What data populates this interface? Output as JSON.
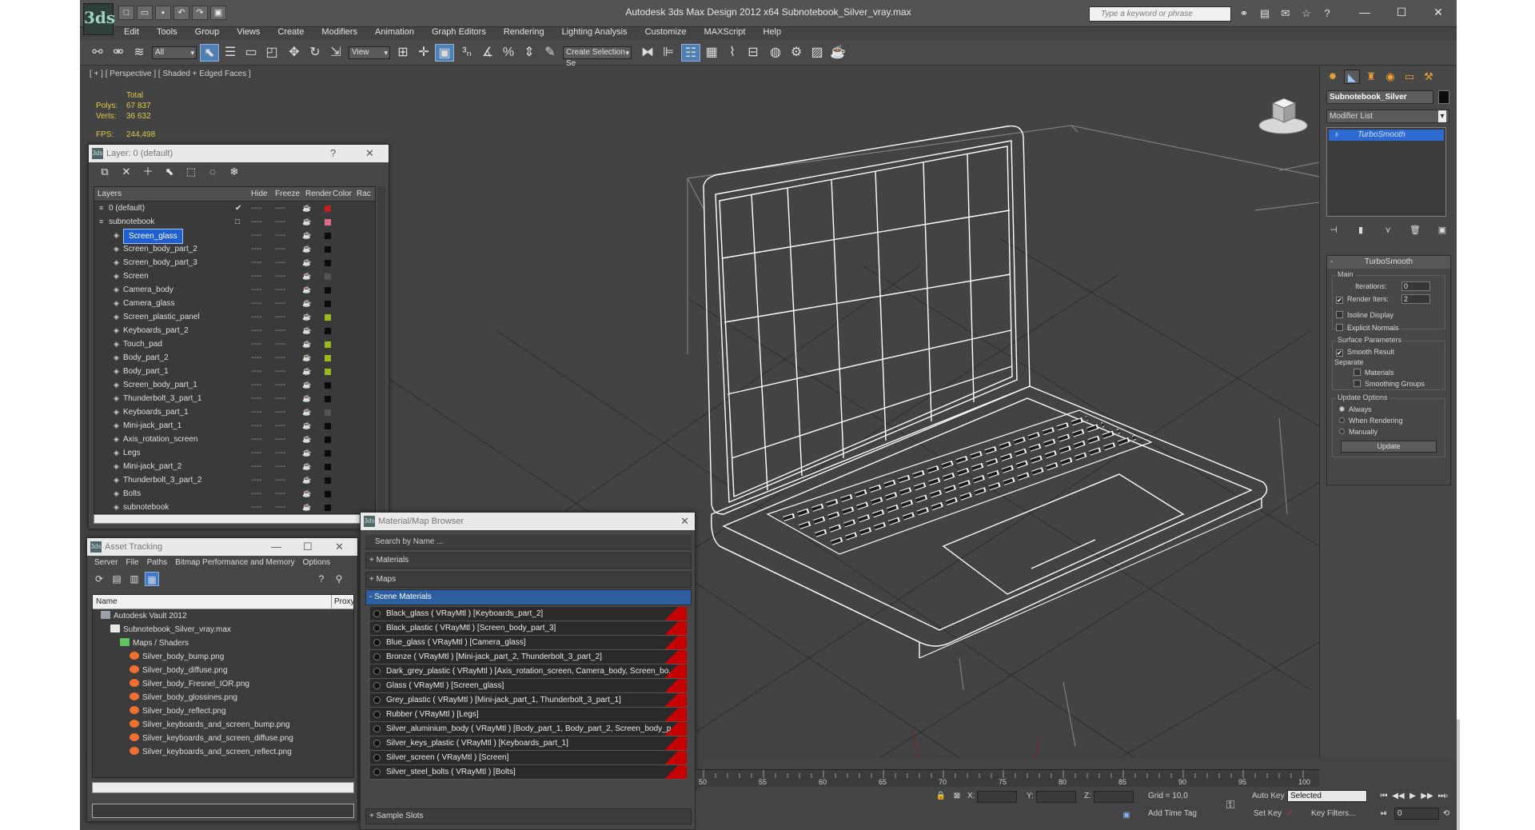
{
  "app": {
    "title": "Autodesk 3ds Max Design 2012 x64      Subnotebook_Silver_vray.max",
    "logo": "3ds",
    "search_placeholder": "Type a keyword or phrase"
  },
  "quick_access": [
    "new-file",
    "open-file",
    "save-file",
    "undo",
    "redo",
    "project-folder"
  ],
  "menu": [
    "Edit",
    "Tools",
    "Group",
    "Views",
    "Create",
    "Modifiers",
    "Animation",
    "Graph Editors",
    "Rendering",
    "Lighting Analysis",
    "Customize",
    "MAXScript",
    "Help"
  ],
  "toolbar": {
    "selection_filter": "All",
    "ref_coord": "View",
    "named_selection": "Create Selection Se"
  },
  "viewport": {
    "label": "[ + ] [ Perspective ] [ Shaded + Edged Faces ]",
    "stats": {
      "header": "Total",
      "polys_label": "Polys:",
      "polys_value": "67 837",
      "verts_label": "Verts:",
      "verts_value": "36 632",
      "fps_label": "FPS:",
      "fps_value": "244,498"
    }
  },
  "layer_window": {
    "title": "Layer: 0 (default)",
    "columns": [
      "Layers",
      "Hide",
      "Freeze",
      "Render",
      "Color",
      "Rac"
    ],
    "rows": [
      {
        "name": "0 (default)",
        "top": true,
        "color": "#c0202a",
        "check": "✔"
      },
      {
        "name": "subnotebook",
        "top": true,
        "color": "#e06a88",
        "check": "□"
      },
      {
        "name": "Screen_glass",
        "color": "#0b0b0b",
        "selected": true
      },
      {
        "name": "Screen_body_part_2",
        "color": "#0b0b0b"
      },
      {
        "name": "Screen_body_part_3",
        "color": "#0b0b0b"
      },
      {
        "name": "Screen",
        "color": "#555555"
      },
      {
        "name": "Camera_body",
        "color": "#0b0b0b"
      },
      {
        "name": "Camera_glass",
        "color": "#0b0b0b"
      },
      {
        "name": "Screen_plastic_panel",
        "color": "#9ab820"
      },
      {
        "name": "Keyboards_part_2",
        "color": "#0b0b0b"
      },
      {
        "name": "Touch_pad",
        "color": "#9ab820"
      },
      {
        "name": "Body_part_2",
        "color": "#9ab820"
      },
      {
        "name": "Body_part_1",
        "color": "#9ab820"
      },
      {
        "name": "Screen_body_part_1",
        "color": "#0b0b0b"
      },
      {
        "name": "Thunderbolt_3_part_1",
        "color": "#0b0b0b"
      },
      {
        "name": "Keyboards_part_1",
        "color": "#555555"
      },
      {
        "name": "Mini-jack_part_1",
        "color": "#0b0b0b"
      },
      {
        "name": "Axis_rotation_screen",
        "color": "#0b0b0b"
      },
      {
        "name": "Legs",
        "color": "#0b0b0b"
      },
      {
        "name": "Mini-jack_part_2",
        "color": "#0b0b0b"
      },
      {
        "name": "Thunderbolt_3_part_2",
        "color": "#0b0b0b"
      },
      {
        "name": "Bolts",
        "color": "#0b0b0b"
      },
      {
        "name": "subnotebook",
        "color": "#0b0b0b"
      }
    ]
  },
  "asset_window": {
    "title": "Asset Tracking",
    "menu": [
      "Server",
      "File",
      "Paths",
      "Bitmap Performance and Memory",
      "Options"
    ],
    "columns": [
      "Name",
      "Proxy"
    ],
    "rows": [
      {
        "name": "Autodesk Vault 2012",
        "indent": 0,
        "kind": "vault"
      },
      {
        "name": "Subnotebook_Silver_vray.max",
        "indent": 1,
        "kind": "file"
      },
      {
        "name": "Maps / Shaders",
        "indent": 2,
        "kind": "folder"
      },
      {
        "name": "Silver_body_bump.png",
        "indent": 3,
        "kind": "map"
      },
      {
        "name": "Silver_body_diffuse.png",
        "indent": 3,
        "kind": "map"
      },
      {
        "name": "Silver_body_Fresnel_IOR.png",
        "indent": 3,
        "kind": "map"
      },
      {
        "name": "Silver_body_glossines.png",
        "indent": 3,
        "kind": "map"
      },
      {
        "name": "Silver_body_reflect.png",
        "indent": 3,
        "kind": "map"
      },
      {
        "name": "Silver_keyboards_and_screen_bump.png",
        "indent": 3,
        "kind": "map"
      },
      {
        "name": "Silver_keyboards_and_screen_diffuse.png",
        "indent": 3,
        "kind": "map"
      },
      {
        "name": "Silver_keyboards_and_screen_reflect.png",
        "indent": 3,
        "kind": "map"
      }
    ]
  },
  "material_browser": {
    "title": "Material/Map Browser",
    "search_placeholder": "Search by Name ...",
    "groups": [
      "+ Materials",
      "+ Maps",
      "- Scene Materials",
      "+ Sample Slots"
    ],
    "materials": [
      "Black_glass  ( VRayMtl ) [Keyboards_part_2]",
      "Black_plastic  ( VRayMtl ) [Screen_body_part_3]",
      "Blue_glass  ( VRayMtl ) [Camera_glass]",
      "Bronze  ( VRayMtl ) [Mini-jack_part_2, Thunderbolt_3_part_2]",
      "Dark_grey_plastic  ( VRayMtl ) [Axis_rotation_screen, Camera_body, Screen_bo...",
      "Glass  ( VRayMtl ) [Screen_glass]",
      "Grey_plastic  ( VRayMtl ) [Mini-jack_part_1, Thunderbolt_3_part_1]",
      "Rubber  ( VRayMtl ) [Legs]",
      "Silver_aluminium_body  ( VRayMtl ) [Body_part_1, Body_part_2, Screen_body_p...",
      "Silver_keys_plastic  ( VRayMtl ) [Keyboards_part_1]",
      "Silver_screen  ( VRayMtl ) [Screen]",
      "Silver_steel_bolts  ( VRayMtl ) [Bolts]"
    ]
  },
  "command_panel": {
    "object_name": "Subnotebook_Silver",
    "modifier_list": "Modifier List",
    "stack_item": "TurboSmooth",
    "rollout_title": "TurboSmooth",
    "main_label": "Main",
    "iterations_label": "Iterations:",
    "iterations_value": "0",
    "render_iters_label": "Render Iters:",
    "render_iters_value": "2",
    "isoline": "Isoline Display",
    "explicit_normals": "Explicit Normals",
    "surface_params": "Surface Parameters",
    "smooth_result": "Smooth Result",
    "separate": "Separate",
    "materials": "Materials",
    "smoothing_groups": "Smoothing Groups",
    "update_options": "Update Options",
    "always": "Always",
    "when_rendering": "When Rendering",
    "manually": "Manually",
    "update_btn": "Update"
  },
  "timeline": {
    "ticks": [
      "50",
      "55",
      "60",
      "65",
      "70",
      "75",
      "80",
      "85",
      "90",
      "95",
      "100"
    ]
  },
  "statusbar": {
    "x_label": "X:",
    "y_label": "Y:",
    "z_label": "Z:",
    "grid": "Grid = 10,0",
    "add_time_tag": "Add Time Tag",
    "auto_key": "Auto Key",
    "selected": "Selected",
    "set_key": "Set Key",
    "key_filters": "Key Filters...",
    "frame": "0"
  }
}
